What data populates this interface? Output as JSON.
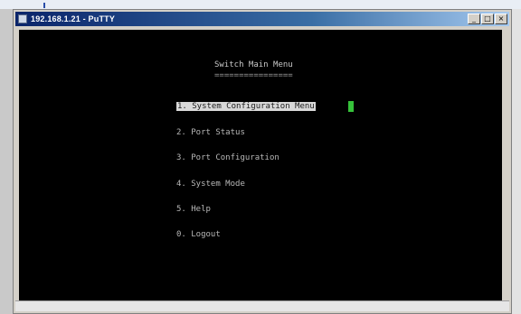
{
  "window": {
    "title": "192.168.1.21 - PuTTY",
    "buttons": {
      "minimize": "_",
      "maximize": "□",
      "close": "×"
    }
  },
  "terminal": {
    "menu_title": "Switch Main Menu",
    "menu_underline": "================",
    "items": [
      {
        "label": "1. System Configuration Menu",
        "selected": true
      },
      {
        "label": "2. Port Status",
        "selected": false
      },
      {
        "label": "3. Port Configuration",
        "selected": false
      },
      {
        "label": "4. System Mode",
        "selected": false
      },
      {
        "label": "5. Help",
        "selected": false
      },
      {
        "label": "0. Logout",
        "selected": false
      }
    ]
  },
  "statusbar": {
    "text": ""
  },
  "colors": {
    "terminal_bg": "#000000",
    "title_gradient_start": "#0a246a",
    "cursor": "#36c23a",
    "selection": "#d8d8d8"
  }
}
